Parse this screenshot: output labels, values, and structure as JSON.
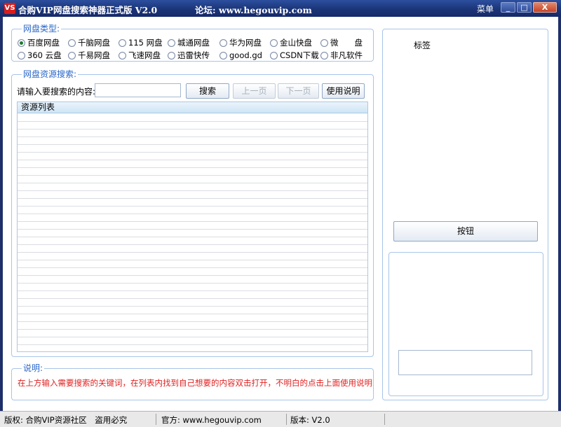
{
  "titlebar": {
    "app_icon": "VS",
    "title": "合购VIP网盘搜索神器正式版 V2.0",
    "forum": "论坛: www.hegouvip.com",
    "menu": "菜单",
    "minimize": "_",
    "maximize": "□",
    "close": "X"
  },
  "disk_group": {
    "title": "网盘类型:",
    "row1": [
      "百度网盘",
      "千脑网盘",
      "115 网盘",
      "城通网盘",
      "华为网盘",
      "金山快盘",
      "微　　盘"
    ],
    "row2": [
      "360 云盘",
      "千易网盘",
      "飞速网盘",
      "迅雷快传",
      "good.gd",
      "CSDN下载",
      "非凡软件"
    ],
    "selected": "百度网盘"
  },
  "search_group": {
    "title": "网盘资源搜索:",
    "label": "请输入要搜索的内容:",
    "input_value": "",
    "search_btn": "搜索",
    "prev_btn": "上一页",
    "next_btn": "下一页",
    "help_btn": "使用说明",
    "list_header": "资源列表"
  },
  "info_group": {
    "title": "说明:",
    "text": "在上方输入需要搜索的关键词，在列表内找到自己想要的内容双击打开，不明白的点击上面使用说明"
  },
  "right_panel": {
    "label": "标签",
    "button": "按钮"
  },
  "statusbar": {
    "copyright": "版权: 合购VIP资源社区　盗用必究",
    "official": "官方: www.hegouvip.com",
    "version": "版本: V2.0"
  }
}
